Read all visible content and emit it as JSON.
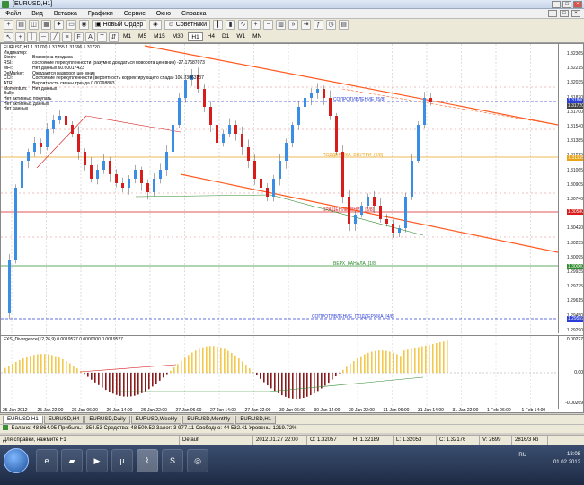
{
  "window": {
    "title": "[EURUSD,H1]"
  },
  "menu": [
    "Файл",
    "Вид",
    "Вставка",
    "Графики",
    "Сервис",
    "Окно",
    "Справка"
  ],
  "toolbar": {
    "new_order": "Новый Ордер",
    "advisors": "Советники"
  },
  "timeframes": [
    "M1",
    "M5",
    "M15",
    "M30",
    "H1",
    "H4",
    "D1",
    "W1",
    "MN"
  ],
  "chart": {
    "header": "EURUSD,H1  1.31700 1.31755 1.31696 1.31720",
    "indicators": [
      {
        "k": "Индикатор:",
        "v": ""
      },
      {
        "k": "Stoch:",
        "v": "Возможна продажа"
      },
      {
        "k": "RSI:",
        "v": "состояние перекупленности (разумно дождаться поворота цен вниз) -27.17687073"
      },
      {
        "k": "MFI:",
        "v": "Нет данных 60.60017423"
      },
      {
        "k": "DeMarker:",
        "v": "Ожидается разворот цен вниз"
      },
      {
        "k": "CCI:",
        "v": "Состояние перекупленности (вероятность корректирующего спада) 106.73063737"
      },
      {
        "k": "ATR:",
        "v": "Вероятность смены тренда 0.00298883"
      },
      {
        "k": "Momentum:",
        "v": "Нет данных"
      },
      {
        "k": "Bulls:",
        "v": ""
      },
      {
        "k": "Нет активных покупать",
        "v": ""
      },
      {
        "k": "Нет активных данных",
        "v": ""
      },
      {
        "k": "Нет данных",
        "v": ""
      }
    ],
    "level_labels": {
      "resist": "СОПРОТИВЛЕНИЕ_[5/8]",
      "support": "ПОДДЕРЖКА_ВНУТРИ_[2/8]",
      "turn": "ВРАЩЕНИЕ_ВНИЗ_[3/8]",
      "channel": "ВЕРХ_КАНАЛА_[1/8]",
      "sup_res": "СОПРОТИВЛЕНИЕ_ПОДДЕРЖКА_[4/8]"
    },
    "price_ticks": [
      "1.32365",
      "1.32215",
      "1.32035",
      "1.31870",
      "1.31700",
      "1.31540",
      "1.31385",
      "1.31225",
      "1.31065",
      "1.30905",
      "1.30740",
      "1.30585",
      "1.30420",
      "1.30255",
      "1.30095",
      "1.29935",
      "1.29775",
      "1.29615",
      "1.29450",
      "1.29290"
    ],
    "price_labels": [
      {
        "text": "1.31800",
        "color": "#2b3fd6"
      },
      {
        "text": "1.31720",
        "color": "#444444"
      },
      {
        "text": "1.31155",
        "color": "#e8a317"
      },
      {
        "text": "1.30580",
        "color": "#d81b1b"
      },
      {
        "text": "1.30000",
        "color": "#2e8b2e"
      },
      {
        "text": "1.29559",
        "color": "#2b3fd6"
      }
    ],
    "time_ticks": [
      "25 Jan 2012",
      "25 Jan 22:00",
      "26 Jan 06:00",
      "26 Jan 14:00",
      "26 Jan 22:00",
      "27 Jan 06:00",
      "27 Jan 14:00",
      "27 Jan 22:00",
      "30 Jan 06:00",
      "30 Jan 14:00",
      "30 Jan 22:00",
      "31 Jan 06:00",
      "31 Jan 14:00",
      "31 Jan 22:00",
      "1 Feb 06:00",
      "1 Feb 14:00"
    ],
    "osc_label": "FXS_Divergence(12,26,9) 0.0019527 0.0000000 0.0019527",
    "osc_ticks": [
      "0.00227",
      "0.00",
      "-0.00269"
    ]
  },
  "tabs": [
    "EURUSD,H1",
    "EURUSD,H4",
    "EURUSD,Daily",
    "EURUSD,Weekly",
    "EURUSD,Monthly",
    "EURUSD,H1"
  ],
  "account": "Баланс: 48 864.05  Прибыль: -354.53  Средства: 48 509.52  Залог: 3 977.11  Свободно: 44 532.41  Уровень: 1219.72%",
  "statusbar": [
    "Для справки, нажмите F1",
    "Default",
    "2012.01.27 22:00",
    "O: 1.32057",
    "H: 1.32189",
    "L: 1.32053",
    "C: 1.32176",
    "V: 2699",
    "2816/3 kb"
  ],
  "tray": {
    "lang": "RU",
    "time": "18:08",
    "date": "01.02.2012"
  },
  "colors": {
    "bull": "#3a8ee6",
    "bear": "#d81b1b",
    "channel": "#ff5a1f"
  }
}
